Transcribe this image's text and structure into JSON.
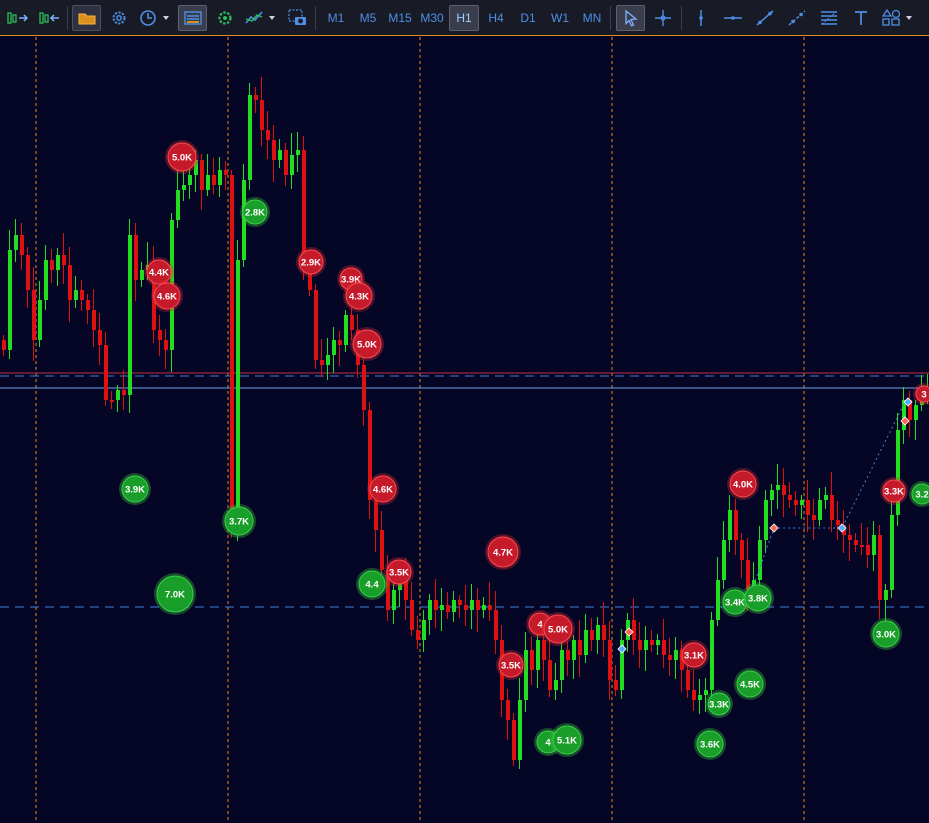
{
  "toolbar": {
    "timeframes": [
      "M1",
      "M5",
      "M15",
      "M30",
      "H1",
      "H4",
      "D1",
      "W1",
      "MN"
    ],
    "active_timeframe": "H1",
    "icons": [
      "autoscroll-icon",
      "chart-shift-icon",
      "folder-icon",
      "settings-gear-icon",
      "clock-icon",
      "volumes-icon",
      "flower-settings-icon",
      "indicators-icon",
      "screenshot-camera-icon",
      "cursor-icon",
      "crosshair-icon",
      "vertical-line-icon",
      "horizontal-line-icon",
      "trend-line-icon",
      "ray-icon",
      "fibonacci-levels-icon",
      "text-icon",
      "shapes-icon"
    ]
  },
  "chart": {
    "colors": {
      "background": "#050625",
      "bull": "#22dd22",
      "bear": "#dd1111",
      "separator": "#e08a1c",
      "level_blue": "#3a7fd6",
      "level_red": "#c0303f"
    },
    "bull_bubbles": [
      "2.8K",
      "3.9K",
      "3.7K",
      "7.0K",
      "4.4",
      "4",
      "5.1K",
      "3.4K",
      "3.8K",
      "4.5K",
      "3.3K",
      "3.6K",
      "3.0K",
      "3.2"
    ],
    "bear_bubbles": [
      "5.0K",
      "4.4K",
      "4.6K",
      "2.9K",
      "3.9K",
      "4.3K",
      "5.0K",
      "4.6K",
      "3.5K",
      "4.7K",
      "4",
      "5.0K",
      "3.5K",
      "3.1K",
      "4.0K",
      "3.3K",
      "3"
    ]
  }
}
